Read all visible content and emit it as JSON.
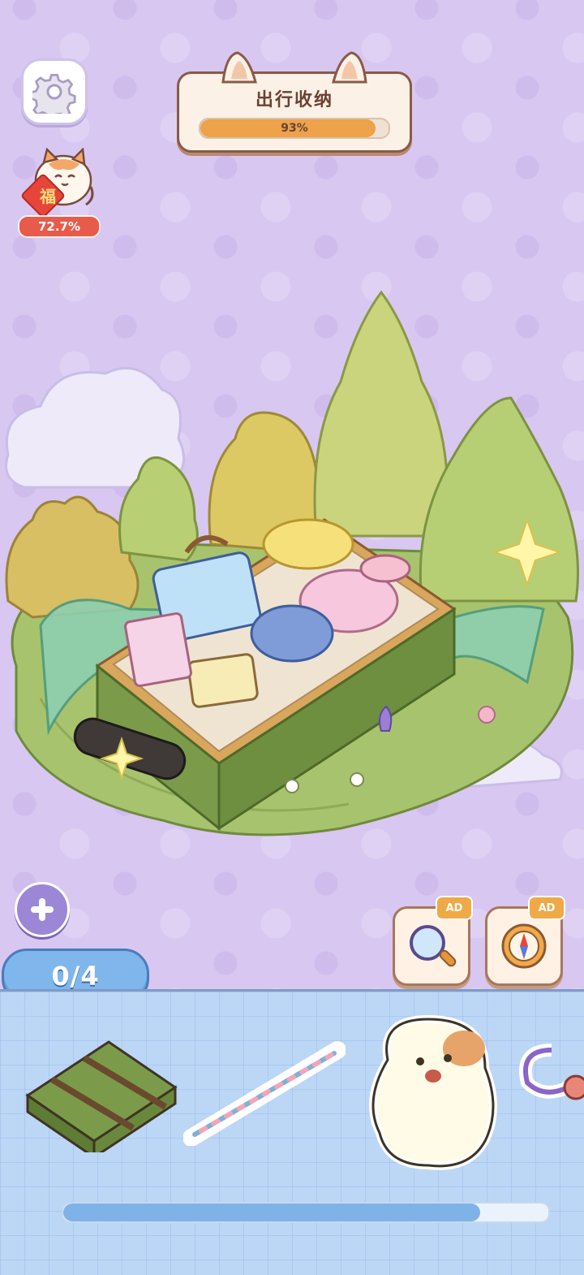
{
  "level": {
    "title": "出行收纳",
    "progress_percent": 93,
    "progress_label": "93%"
  },
  "fortune": {
    "badge": "福",
    "percent_label": "72.7%"
  },
  "counter": {
    "label": "0/4"
  },
  "tools": [
    {
      "name": "magnifier",
      "badge": "AD"
    },
    {
      "name": "compass",
      "badge": "AD"
    }
  ],
  "tray": {
    "items": [
      "suitcase",
      "flower-strap",
      "puppy-sticker",
      "keychain"
    ],
    "scroll_position": 0.86
  },
  "colors": {
    "background": "#d8c7f1",
    "accent_orange": "#eea24a",
    "tray_blue": "#bcd6f6",
    "counter_blue": "#7fb6ec"
  }
}
